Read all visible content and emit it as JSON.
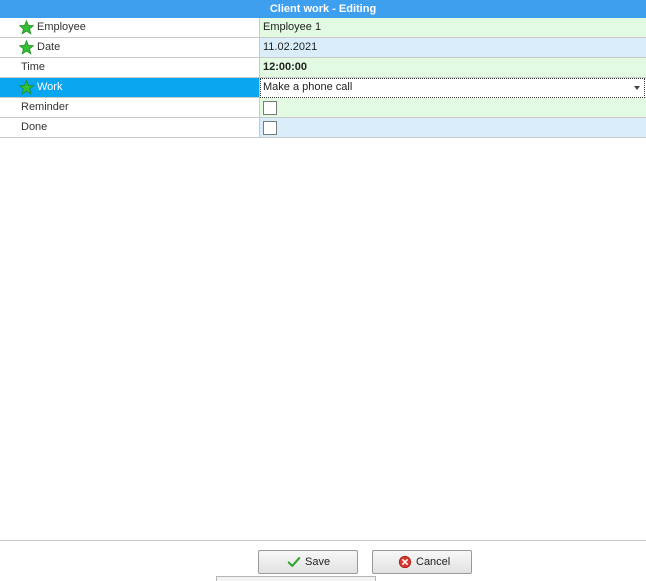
{
  "window": {
    "title": "Client work - Editing"
  },
  "fields": {
    "employee": {
      "label": "Employee",
      "value": "Employee 1",
      "required": true
    },
    "date": {
      "label": "Date",
      "value": "11.02.2021",
      "required": true
    },
    "time": {
      "label": "Time",
      "value": "12:00:00"
    },
    "work": {
      "label": "Work",
      "value": "Make a phone call",
      "required": true,
      "selected": true
    },
    "reminder": {
      "label": "Reminder",
      "checked": false
    },
    "done": {
      "label": "Done",
      "checked": false
    }
  },
  "buttons": {
    "save_label": "Save",
    "cancel_label": "Cancel"
  },
  "colors": {
    "title_bar": "#3f9fef",
    "selected_row": "#0aa6f0",
    "value_green": "#e2f9e2",
    "value_blue": "#d9eefa",
    "required_star": "#33c133"
  },
  "icons": {
    "required": "star-icon",
    "save": "checkmark-icon",
    "cancel": "cancel-icon",
    "dropdown": "chevron-down-icon"
  }
}
